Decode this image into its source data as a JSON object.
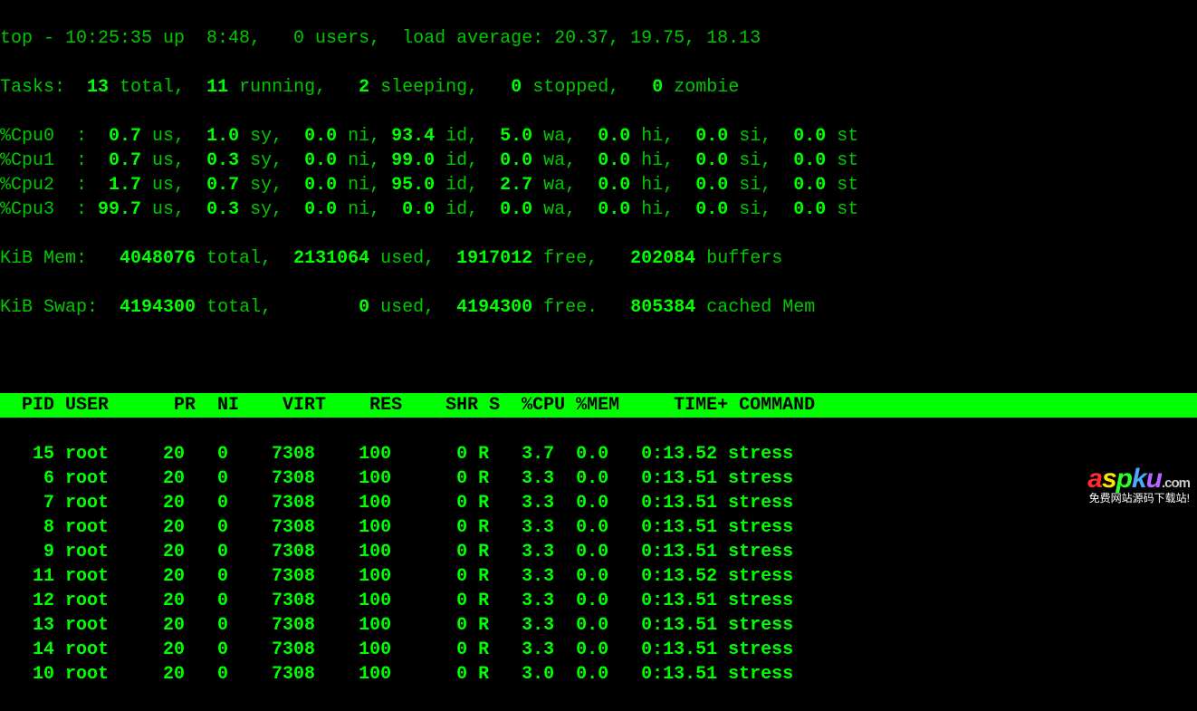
{
  "summary": {
    "line1_prefix": "top - 10:25:35 up  8:48,   0 users,  load average: 20.37, 19.75, 18.13",
    "tasks": {
      "label": "Tasks:",
      "total": "13",
      "total_l": " total,",
      "running": "11",
      "running_l": " running,",
      "sleeping": "2",
      "sleeping_l": " sleeping,",
      "stopped": "0",
      "stopped_l": " stopped,",
      "zombie": "0",
      "zombie_l": " zombie"
    },
    "cpus": [
      {
        "name": "%Cpu0  :",
        "us": "0.7",
        "sy": "1.0",
        "ni": "0.0",
        "id": "93.4",
        "wa": "5.0",
        "hi": "0.0",
        "si": "0.0",
        "st": "0.0"
      },
      {
        "name": "%Cpu1  :",
        "us": "0.7",
        "sy": "0.3",
        "ni": "0.0",
        "id": "99.0",
        "wa": "0.0",
        "hi": "0.0",
        "si": "0.0",
        "st": "0.0"
      },
      {
        "name": "%Cpu2  :",
        "us": "1.7",
        "sy": "0.7",
        "ni": "0.0",
        "id": "95.0",
        "wa": "2.7",
        "hi": "0.0",
        "si": "0.0",
        "st": "0.0"
      },
      {
        "name": "%Cpu3  :",
        "us": "99.7",
        "sy": "0.3",
        "ni": "0.0",
        "id": "0.0",
        "wa": "0.0",
        "hi": "0.0",
        "si": "0.0",
        "st": "0.0"
      }
    ],
    "mem": {
      "label": "KiB Mem:",
      "total": "4048076",
      "total_l": " total,",
      "used": "2131064",
      "used_l": " used,",
      "free": "1917012",
      "free_l": " free,",
      "buf": "202084",
      "buf_l": " buffers"
    },
    "swap": {
      "label": "KiB Swap:",
      "total": "4194300",
      "total_l": " total,",
      "used": "0",
      "used_l": " used,",
      "free": "4194300",
      "free_l": " free.",
      "cache": "805384",
      "cache_l": " cached Mem"
    }
  },
  "columns": "  PID USER      PR  NI    VIRT    RES    SHR S  %CPU %MEM     TIME+ COMMAND           ",
  "processes": [
    {
      "pid": "15",
      "user": "root",
      "pr": "20",
      "ni": "0",
      "virt": "7308",
      "res": "100",
      "shr": "0",
      "s": "R",
      "cpu": "3.7",
      "mem": "0.0",
      "time": "0:13.52",
      "cmd": "stress"
    },
    {
      "pid": "6",
      "user": "root",
      "pr": "20",
      "ni": "0",
      "virt": "7308",
      "res": "100",
      "shr": "0",
      "s": "R",
      "cpu": "3.3",
      "mem": "0.0",
      "time": "0:13.51",
      "cmd": "stress"
    },
    {
      "pid": "7",
      "user": "root",
      "pr": "20",
      "ni": "0",
      "virt": "7308",
      "res": "100",
      "shr": "0",
      "s": "R",
      "cpu": "3.3",
      "mem": "0.0",
      "time": "0:13.51",
      "cmd": "stress"
    },
    {
      "pid": "8",
      "user": "root",
      "pr": "20",
      "ni": "0",
      "virt": "7308",
      "res": "100",
      "shr": "0",
      "s": "R",
      "cpu": "3.3",
      "mem": "0.0",
      "time": "0:13.51",
      "cmd": "stress"
    },
    {
      "pid": "9",
      "user": "root",
      "pr": "20",
      "ni": "0",
      "virt": "7308",
      "res": "100",
      "shr": "0",
      "s": "R",
      "cpu": "3.3",
      "mem": "0.0",
      "time": "0:13.51",
      "cmd": "stress"
    },
    {
      "pid": "11",
      "user": "root",
      "pr": "20",
      "ni": "0",
      "virt": "7308",
      "res": "100",
      "shr": "0",
      "s": "R",
      "cpu": "3.3",
      "mem": "0.0",
      "time": "0:13.52",
      "cmd": "stress"
    },
    {
      "pid": "12",
      "user": "root",
      "pr": "20",
      "ni": "0",
      "virt": "7308",
      "res": "100",
      "shr": "0",
      "s": "R",
      "cpu": "3.3",
      "mem": "0.0",
      "time": "0:13.51",
      "cmd": "stress"
    },
    {
      "pid": "13",
      "user": "root",
      "pr": "20",
      "ni": "0",
      "virt": "7308",
      "res": "100",
      "shr": "0",
      "s": "R",
      "cpu": "3.3",
      "mem": "0.0",
      "time": "0:13.51",
      "cmd": "stress"
    },
    {
      "pid": "14",
      "user": "root",
      "pr": "20",
      "ni": "0",
      "virt": "7308",
      "res": "100",
      "shr": "0",
      "s": "R",
      "cpu": "3.3",
      "mem": "0.0",
      "time": "0:13.51",
      "cmd": "stress"
    },
    {
      "pid": "10",
      "user": "root",
      "pr": "20",
      "ni": "0",
      "virt": "7308",
      "res": "100",
      "shr": "0",
      "s": "R",
      "cpu": "3.0",
      "mem": "0.0",
      "time": "0:13.51",
      "cmd": "stress"
    }
  ],
  "watermark": {
    "brand_a": "a",
    "brand_s": "s",
    "brand_p": "p",
    "brand_k": "k",
    "brand_u": "u",
    "brand_dot": ".com",
    "sub": "免费网站源码下载站!"
  }
}
